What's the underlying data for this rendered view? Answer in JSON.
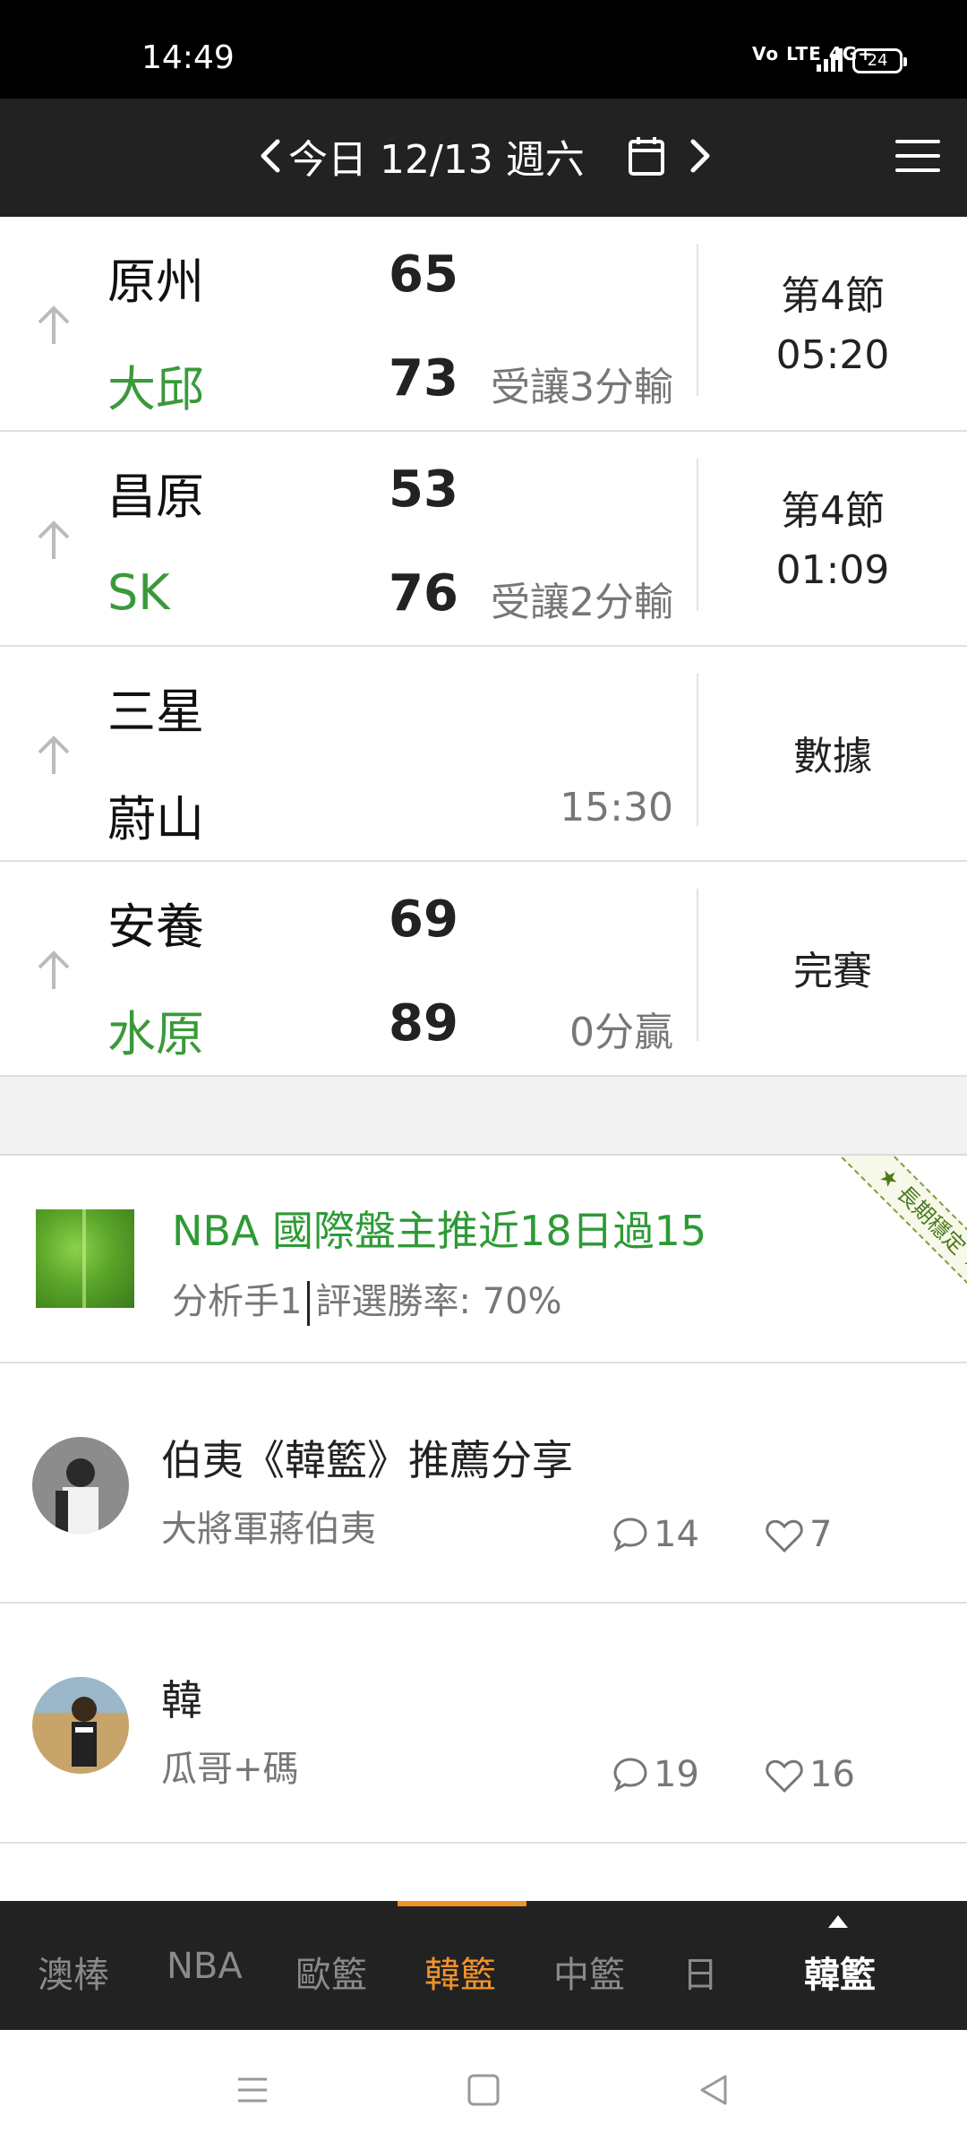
{
  "status_bar": {
    "time": "14:49",
    "network": "Vo LTE 4G+",
    "battery": "24",
    "signal_icon": "signal-icon",
    "battery_icon": "battery-icon"
  },
  "header": {
    "title": "今日 12/13 週六",
    "prev_icon": "chevron-left-icon",
    "next_icon": "chevron-right-icon",
    "calendar_icon": "calendar-icon",
    "menu_icon": "hamburger-menu-icon"
  },
  "matches": [
    {
      "home": "原州",
      "away": "大邱",
      "home_score": "65",
      "away_score": "73",
      "note": "受讓3分輸",
      "status_line1": "第4節",
      "status_line2": "05:20"
    },
    {
      "home": "昌原",
      "away": "SK",
      "home_score": "53",
      "away_score": "76",
      "note": "受讓2分輸",
      "status_line1": "第4節",
      "status_line2": "01:09"
    },
    {
      "home": "三星",
      "away": "蔚山",
      "home_score": "",
      "away_score": "",
      "note": "15:30",
      "status_line1": "數據",
      "status_line2": ""
    },
    {
      "home": "安養",
      "away": "水原",
      "home_score": "69",
      "away_score": "89",
      "note": "0分贏",
      "status_line1": "完賽",
      "status_line2": ""
    }
  ],
  "promo": {
    "title": "NBA 國際盤主推近18日過15",
    "analyst": "分析手1",
    "win_rate": "評選勝率: 70%",
    "ribbon": "★ 長期穩定 ★"
  },
  "posts": [
    {
      "title": "伯夷《韓籃》推薦分享",
      "author": "大將軍蔣伯夷",
      "comments": "14",
      "likes": "7"
    },
    {
      "title": "韓",
      "author": "瓜哥+碼",
      "comments": "19",
      "likes": "16"
    }
  ],
  "tabs": [
    "澳棒",
    "NBA",
    "歐籃",
    "韓籃",
    "中籃",
    "日"
  ],
  "active_tab": "韓籃",
  "current_league": "韓籃",
  "colors": {
    "header_bg": "#222222",
    "winner_green": "#3a9a3a",
    "accent_orange": "#f0922a"
  }
}
